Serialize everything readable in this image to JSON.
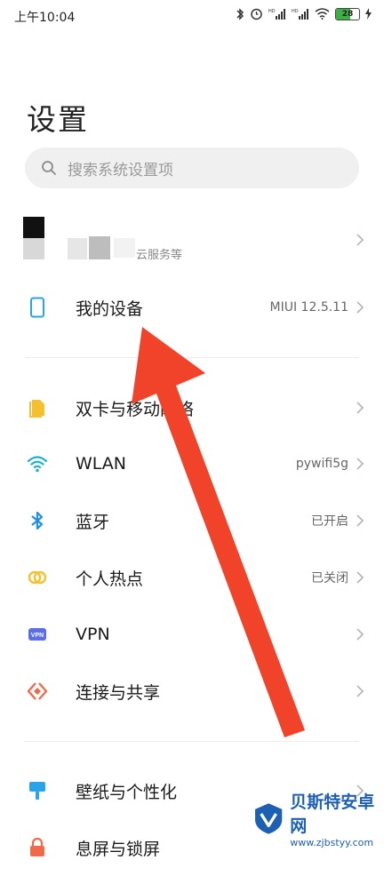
{
  "status_bar": {
    "time": "上午10:04",
    "battery": "28",
    "signal1_label": "HD",
    "signal2_label": "HD"
  },
  "page": {
    "title": "设置"
  },
  "search": {
    "placeholder": "搜索系统设置项"
  },
  "account": {
    "subtitle": "云服务等"
  },
  "rows": [
    {
      "label": "我的设备",
      "value": "MIUI 12.5.11",
      "icon": "phone-icon",
      "color": "#2aa4d9"
    },
    {
      "label": "双卡与移动网络",
      "value": "",
      "icon": "sim-card-icon",
      "color": "#f5c030"
    },
    {
      "label": "WLAN",
      "value": "pywifi5g",
      "icon": "wifi-icon",
      "color": "#1fb0d8"
    },
    {
      "label": "蓝牙",
      "value": "已开启",
      "icon": "bluetooth-icon",
      "color": "#1e90e8"
    },
    {
      "label": "个人热点",
      "value": "已关闭",
      "icon": "hotspot-icon",
      "color": "#f2c230"
    },
    {
      "label": "VPN",
      "value": "",
      "icon": "vpn-icon",
      "color": "#5b6ee8"
    },
    {
      "label": "连接与共享",
      "value": "",
      "icon": "share-icon",
      "color": "#f06a4a"
    },
    {
      "label": "壁纸与个性化",
      "value": "",
      "icon": "wallpaper-icon",
      "color": "#2aa4e8"
    },
    {
      "label": "息屏与锁屏",
      "value": "",
      "icon": "lock-icon",
      "color": "#f06a4a"
    }
  ],
  "watermark": {
    "title": "贝斯特安卓网",
    "url": "www.zjbstyy.com"
  },
  "colors": {
    "arrow": "#f0432a",
    "accent": "#2aa4d9"
  }
}
